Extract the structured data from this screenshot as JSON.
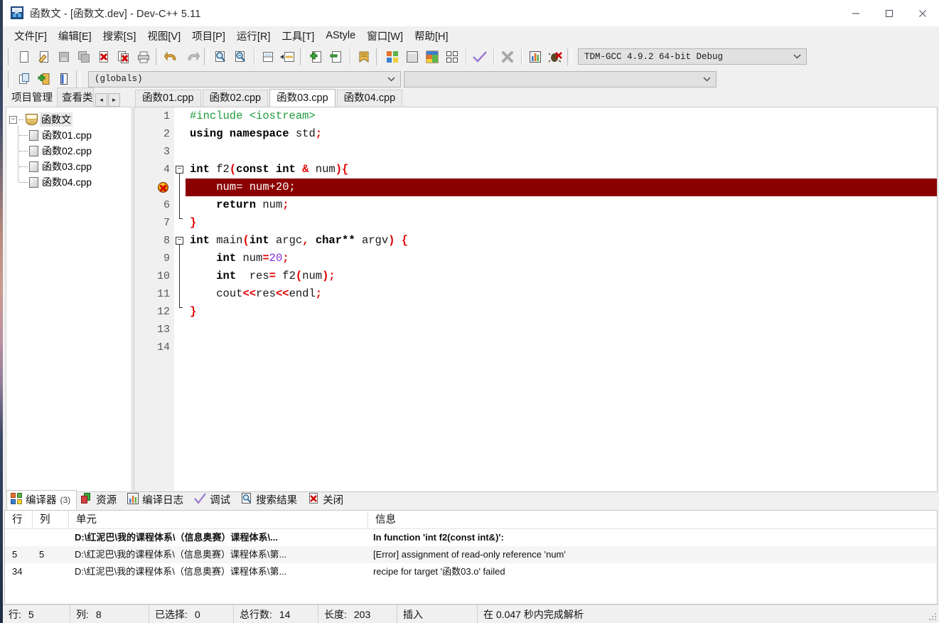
{
  "window": {
    "title": "函数文 - [函数文.dev] - Dev-C++ 5.11",
    "app_icon": "devcpp-icon",
    "minimize": "minimize-icon",
    "maximize": "maximize-icon",
    "close": "close-icon"
  },
  "menubar": {
    "items": [
      {
        "label": "文件[F]"
      },
      {
        "label": "编辑[E]"
      },
      {
        "label": "搜索[S]"
      },
      {
        "label": "视图[V]"
      },
      {
        "label": "项目[P]"
      },
      {
        "label": "运行[R]"
      },
      {
        "label": "工具[T]"
      },
      {
        "label": "AStyle"
      },
      {
        "label": "窗口[W]"
      },
      {
        "label": "帮助[H]"
      }
    ]
  },
  "toolbar": {
    "buttons": [
      "new-file-icon",
      "open-file-icon",
      "save-file-icon",
      "save-all-icon",
      "close-file-icon",
      "close-all-icon",
      "print-icon",
      "undo-icon",
      "redo-icon",
      "find-icon",
      "find-next-icon",
      "goto-line-icon",
      "goto-function-icon",
      "add-to-project-icon",
      "remove-from-project-icon",
      "project-options-icon",
      "compile-icon",
      "run-icon",
      "compile-and-run-icon",
      "rebuild-all-icon",
      "syntax-check-icon",
      "stop-execution-icon",
      "profile-icon",
      "debug-icon"
    ],
    "compiler_combo": "TDM-GCC 4.9.2 64-bit Debug",
    "row2_buttons": [
      "insert-icon",
      "toggle-breakpoint-icon",
      "new-class-icon"
    ],
    "globals_combo": "(globals)",
    "members_combo": ""
  },
  "left_panel": {
    "tabs": [
      {
        "label": "项目管理",
        "active": true
      },
      {
        "label": "查看类",
        "active": false
      }
    ],
    "nav_prev": "arrow-left-icon",
    "nav_next": "arrow-right-icon",
    "tree": {
      "root": "函数文",
      "children": [
        "函数01.cpp",
        "函数02.cpp",
        "函数03.cpp",
        "函数04.cpp"
      ]
    }
  },
  "editor": {
    "tabs": [
      {
        "label": "函数01.cpp",
        "active": false
      },
      {
        "label": "函数02.cpp",
        "active": false
      },
      {
        "label": "函数03.cpp",
        "active": true
      },
      {
        "label": "函数04.cpp",
        "active": false
      }
    ],
    "line_numbers": [
      "1",
      "2",
      "3",
      "4",
      "5",
      "6",
      "7",
      "8",
      "9",
      "10",
      "11",
      "12",
      "13",
      "14"
    ],
    "error_line": 5,
    "error_marker_icon": "error-bullet-icon",
    "code_lines": [
      "#include <iostream>",
      "using namespace std;",
      "",
      "int f2(const int & num){",
      "    num= num+20;",
      "    return num;",
      "}",
      "int main(int argc, char** argv) {",
      "    int num=20;",
      "    int  res= f2(num);",
      "    cout<<res<<endl;",
      "}",
      "",
      ""
    ],
    "highlight_color": "#8b0000"
  },
  "bottom_panel": {
    "tabs": [
      {
        "label": "编译器",
        "count": "(3)",
        "icon": "compiler-icon",
        "active": true
      },
      {
        "label": "资源",
        "count": "",
        "icon": "resource-icon",
        "active": false
      },
      {
        "label": "编译日志",
        "count": "",
        "icon": "compile-log-icon",
        "active": false
      },
      {
        "label": "调试",
        "count": "",
        "icon": "debug-check-icon",
        "active": false
      },
      {
        "label": "搜索结果",
        "count": "",
        "icon": "search-results-icon",
        "active": false
      },
      {
        "label": "关闭",
        "count": "",
        "icon": "close-panel-icon",
        "active": false
      }
    ],
    "columns": [
      "行",
      "列",
      "单元",
      "信息"
    ],
    "rows": [
      {
        "line": "",
        "col": "",
        "unit": "D:\\红泥巴\\我的课程体系\\（信息奥赛）课程体系\\...",
        "message": "In function 'int f2(const int&)':",
        "bold": true
      },
      {
        "line": "5",
        "col": "5",
        "unit": "D:\\红泥巴\\我的课程体系\\（信息奥赛）课程体系\\第...",
        "message": "[Error] assignment of read-only reference 'num'",
        "bold": false
      },
      {
        "line": "34",
        "col": "",
        "unit": "D:\\红泥巴\\我的课程体系\\（信息奥赛）课程体系\\第...",
        "message": "recipe for target '函数03.o' failed",
        "bold": false
      }
    ]
  },
  "statusbar": {
    "cells": [
      {
        "label": "行:",
        "value": "5"
      },
      {
        "label": "列:",
        "value": "8"
      },
      {
        "label": "已选择:",
        "value": "0"
      },
      {
        "label": "总行数:",
        "value": "14"
      },
      {
        "label": "长度:",
        "value": "203"
      },
      {
        "label": "插入",
        "value": ""
      },
      {
        "label": "在 0.047 秒内完成解析",
        "value": ""
      }
    ]
  }
}
